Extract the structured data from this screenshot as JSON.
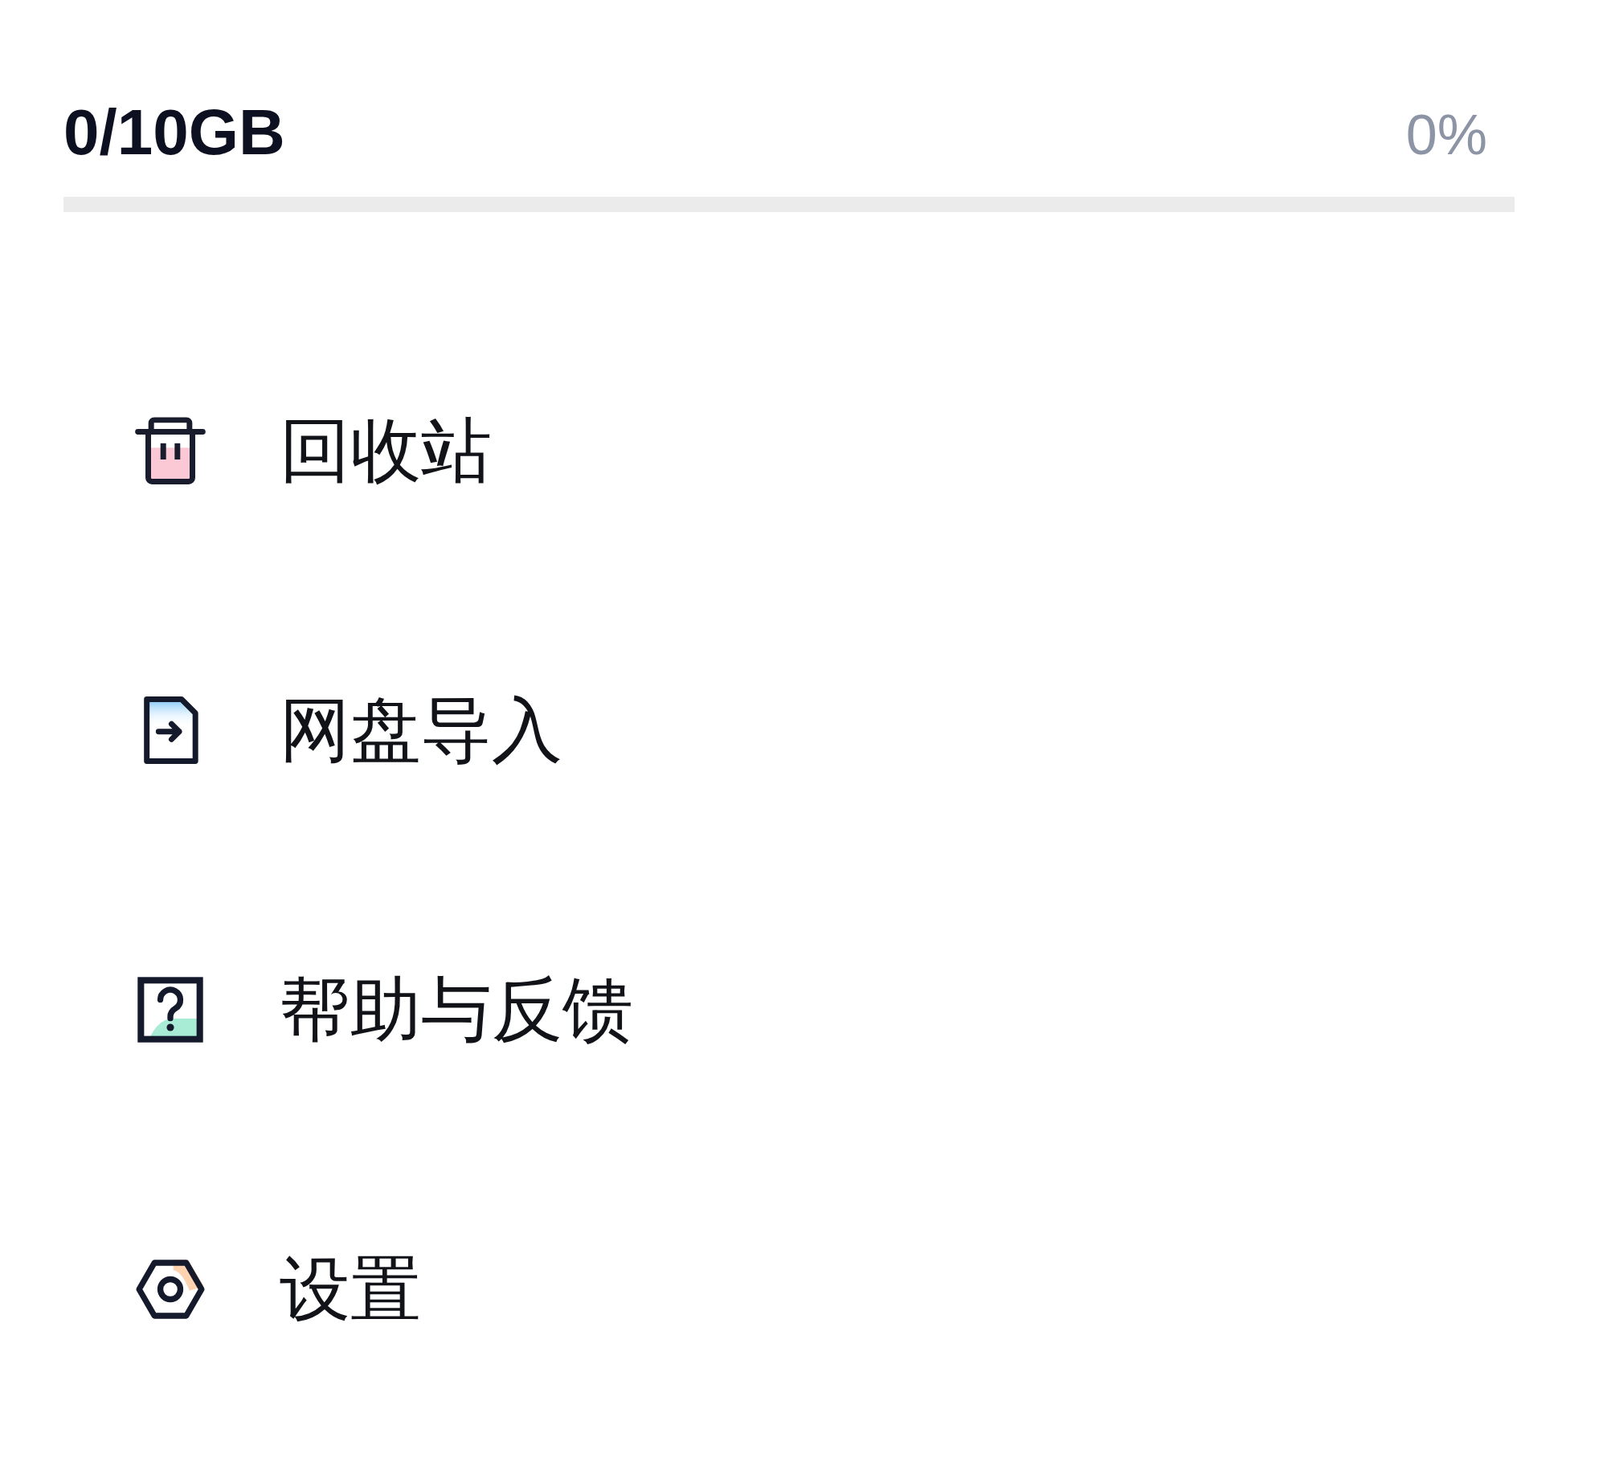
{
  "storage": {
    "usage": "0/10GB",
    "percent": "0%"
  },
  "menu": [
    {
      "label": "回收站"
    },
    {
      "label": "网盘导入"
    },
    {
      "label": "帮助与反馈"
    },
    {
      "label": "设置"
    }
  ]
}
